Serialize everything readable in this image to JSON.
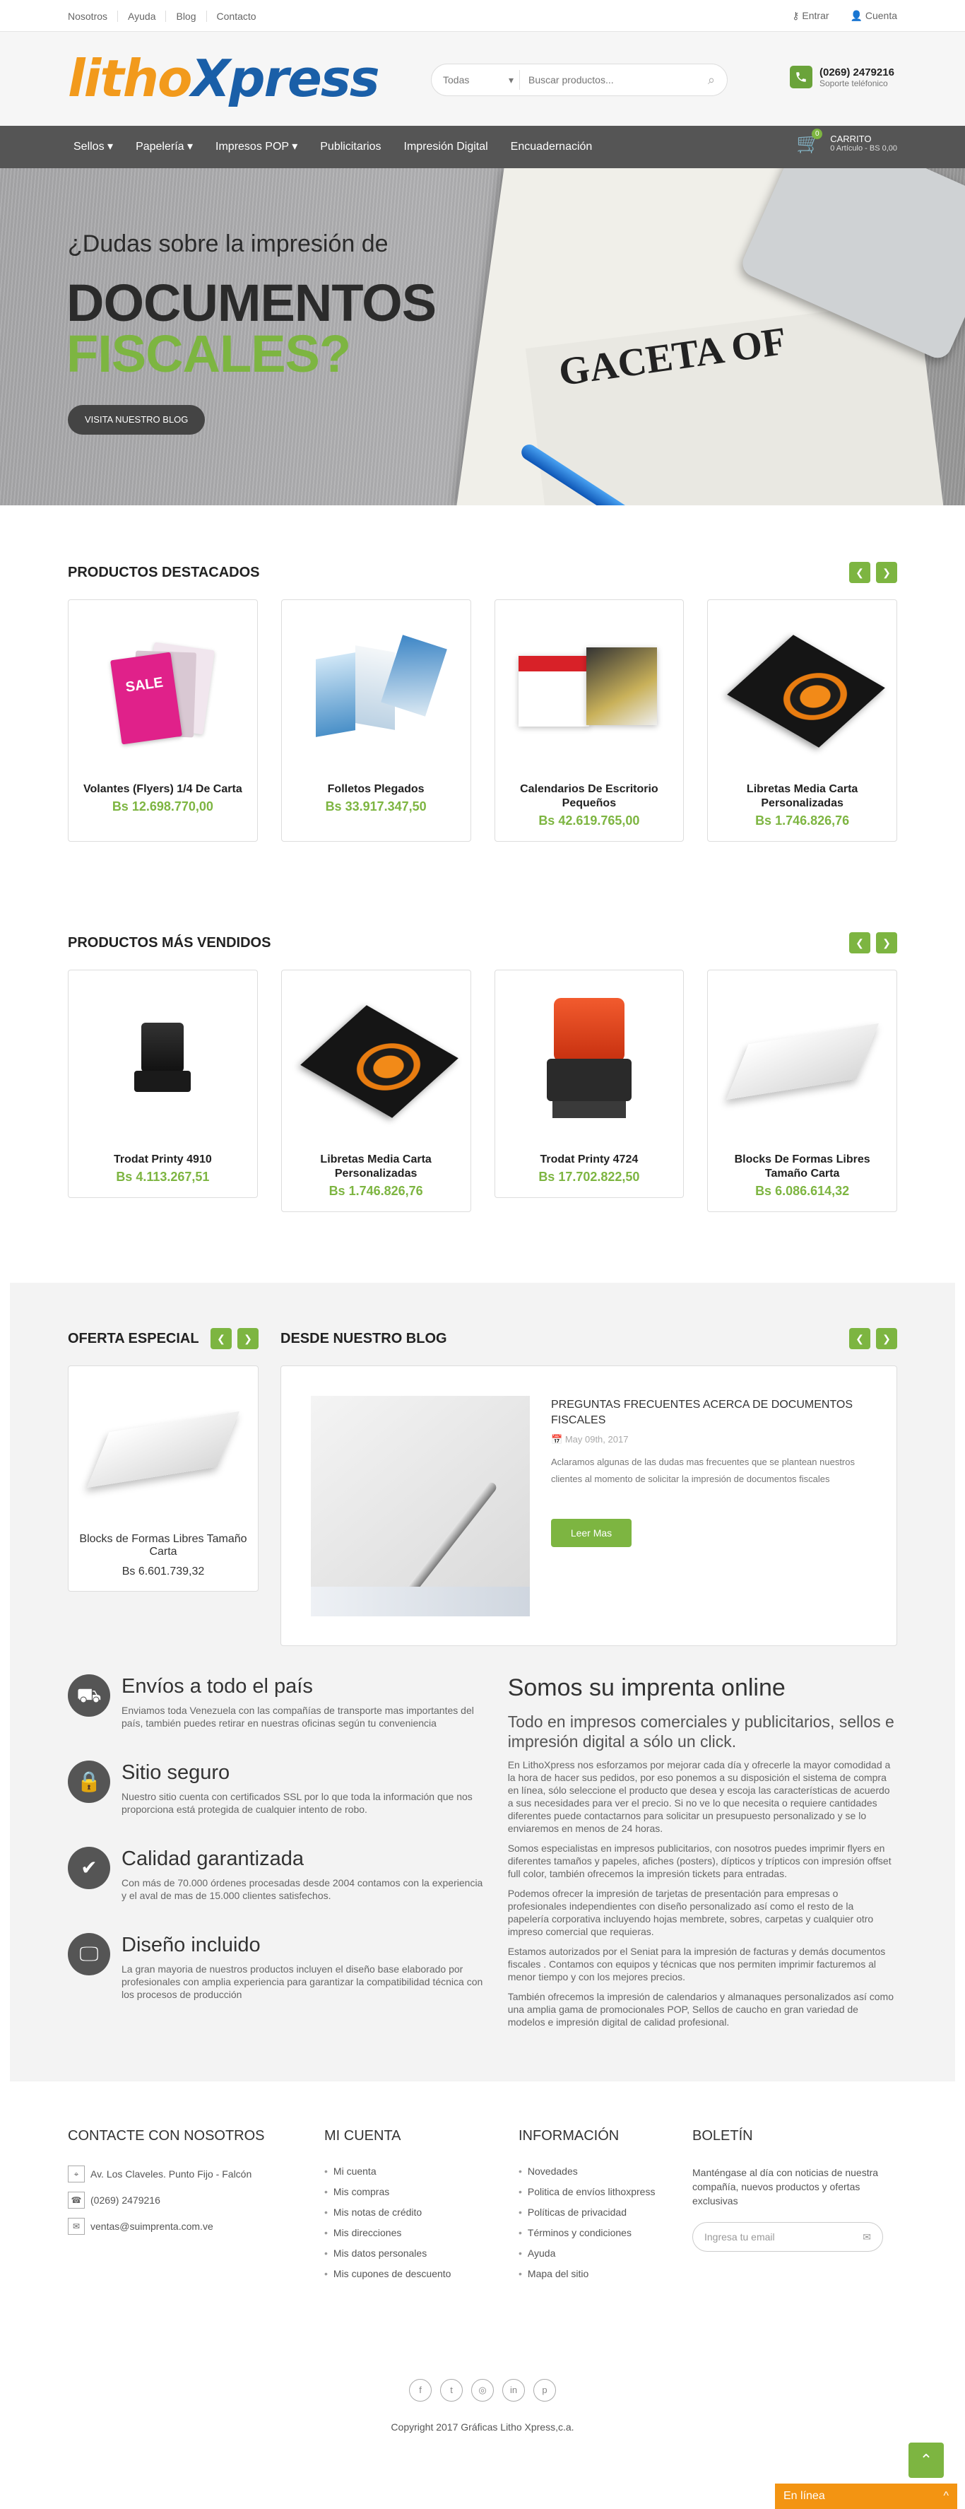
{
  "topbar": {
    "links": [
      "Nosotros",
      "Ayuda",
      "Blog",
      "Contacto"
    ],
    "login": "Entrar",
    "account": "Cuenta"
  },
  "header": {
    "logo_part1": "litho",
    "logo_part2": "Xpress",
    "search_category": "Todas",
    "search_placeholder": "Buscar productos...",
    "phone": "(0269) 2479216",
    "phone_label": "Soporte teléfonico"
  },
  "nav": {
    "items": [
      "Sellos ▾",
      "Papelería ▾",
      "Impresos POP ▾",
      "Publicitarios",
      "Impresión Digital",
      "Encuadernación"
    ],
    "cart_label": "CARRITO",
    "cart_summary": "0 Artículo - BS 0,00",
    "cart_count": "0"
  },
  "hero": {
    "line1": "¿Dudas sobre la impresión de",
    "line2": "DOCUMENTOS",
    "line3": "FISCALES?",
    "button": "VISITA NUESTRO BLOG",
    "paper_text": "GACETA OF"
  },
  "featured": {
    "title": "PRODUCTOS DESTACADOS",
    "products": [
      {
        "name": "Volantes (Flyers) 1/4 De Carta",
        "price": "Bs 12.698.770,00"
      },
      {
        "name": "Folletos Plegados",
        "price": "Bs 33.917.347,50"
      },
      {
        "name": "Calendarios De Escritorio Pequeños",
        "price": "Bs 42.619.765,00"
      },
      {
        "name": "Libretas Media Carta Personalizadas",
        "price": "Bs 1.746.826,76"
      }
    ]
  },
  "bestsellers": {
    "title": "PRODUCTOS MÁS VENDIDOS",
    "products": [
      {
        "name": "Trodat Printy 4910",
        "price": "Bs 4.113.267,51"
      },
      {
        "name": "Libretas Media Carta Personalizadas",
        "price": "Bs 1.746.826,76"
      },
      {
        "name": "Trodat Printy 4724",
        "price": "Bs 17.702.822,50"
      },
      {
        "name": "Blocks De Formas Libres Tamaño Carta",
        "price": "Bs 6.086.614,32"
      }
    ]
  },
  "offer": {
    "title": "OFERTA ESPECIAL",
    "product": {
      "name": "Blocks de Formas Libres Tamaño Carta",
      "price": "Bs 6.601.739,32"
    }
  },
  "blog": {
    "title": "DESDE NUESTRO BLOG",
    "post_title": "PREGUNTAS FRECUENTES ACERCA DE DOCUMENTOS FISCALES",
    "date": "May 09th, 2017",
    "excerpt": "Aclaramos algunas de las dudas mas frecuentes que se plantean nuestros clientes al momento de solicitar la impresión de documentos fiscales",
    "button": "Leer Mas"
  },
  "features": [
    {
      "icon": "truck-icon",
      "glyph": "⛟",
      "title": "Envíos a todo el país",
      "desc": "Enviamos toda Venezuela con las compañías de transporte mas importantes del país, también puedes retirar en nuestras oficinas según tu conveniencia"
    },
    {
      "icon": "lock-icon",
      "glyph": "🔒",
      "title": "Sitio seguro",
      "desc": "Nuestro sitio cuenta con certificados SSL por lo que toda la información que nos proporciona está protegida de cualquier intento de robo."
    },
    {
      "icon": "check-icon",
      "glyph": "✔",
      "title": "Calidad garantizada",
      "desc": "Con más de 70.000 órdenes procesadas desde 2004 contamos con la experiencia y el aval de mas de 15.000 clientes satisfechos."
    },
    {
      "icon": "monitor-icon",
      "glyph": "🖵",
      "title": "Diseño incluido",
      "desc": "La gran mayoria de nuestros productos incluyen el diseño base elaborado por profesionales con amplia experiencia para garantizar la compatibilidad técnica con los procesos de producción"
    }
  ],
  "about": {
    "title": "Somos su imprenta online",
    "subtitle": "Todo en impresos comerciales y publicitarios, sellos e impresión digital a sólo un click.",
    "paragraphs": [
      "En LithoXpress nos esforzamos por mejorar cada día y ofrecerle la mayor comodidad a la hora de hacer sus pedidos, por eso ponemos a su disposición el sistema de compra en línea, sólo seleccione el producto que desea y escoja las características de acuerdo a sus necesidades para ver el precio. Si no ve lo que necesita o requiere cantidades diferentes puede contactarnos para solicitar un presupuesto personalizado y se lo enviaremos en menos de 24 horas.",
      "Somos especialistas en impresos publicitarios, con nosotros puedes imprimir flyers en diferentes tamaños y papeles, afiches (posters), dípticos y trípticos con impresión offset full color, también ofrecemos la impresión tickets para entradas.",
      "Podemos ofrecer la impresión de tarjetas de presentación para empresas o profesionales independientes con diseño personalizado así como el resto de la papelería corporativa incluyendo hojas membrete, sobres, carpetas y cualquier otro impreso comercial que requieras.",
      "Estamos autorizados por el Seniat para la impresión de facturas y demás documentos fiscales . Contamos con equipos y técnicas que nos permiten imprimir facturemos al menor tiempo y con los mejores precios.",
      "También ofrecemos la impresión de calendarios y almanaques personalizados así como una amplia gama de promocionales POP, Sellos de caucho en gran variedad de modelos e impresión digital de calidad profesional."
    ]
  },
  "footer": {
    "contact": {
      "title": "CONTACTE CON NOSOTROS",
      "address": "Av. Los Claveles. Punto Fijo - Falcón",
      "phone": "(0269) 2479216",
      "email": "ventas@suimprenta.com.ve"
    },
    "account": {
      "title": "MI CUENTA",
      "links": [
        "Mi cuenta",
        "Mis compras",
        "Mis notas de crédito",
        "Mis direcciones",
        "Mis datos personales",
        "Mis cupones de descuento"
      ]
    },
    "info": {
      "title": "INFORMACIÓN",
      "links": [
        "Novedades",
        "Politica de envíos lithoxpress",
        "Políticas de privacidad",
        "Términos y condiciones",
        "Ayuda",
        "Mapa del sitio"
      ]
    },
    "newsletter": {
      "title": "BOLETÍN",
      "text": "Manténgase al día con noticias de nuestra compañía, nuevos productos y ofertas exclusivas",
      "placeholder": "Ingresa tu email"
    },
    "social": [
      "f",
      "t",
      "◎",
      "in",
      "p"
    ],
    "copyright": "Copyright 2017 Gráficas Litho Xpress,c.a."
  },
  "chat": {
    "label": "En línea",
    "chevron": "^"
  },
  "colors": {
    "accent": "#7db541",
    "orange": "#f39412",
    "nav": "#555555"
  }
}
